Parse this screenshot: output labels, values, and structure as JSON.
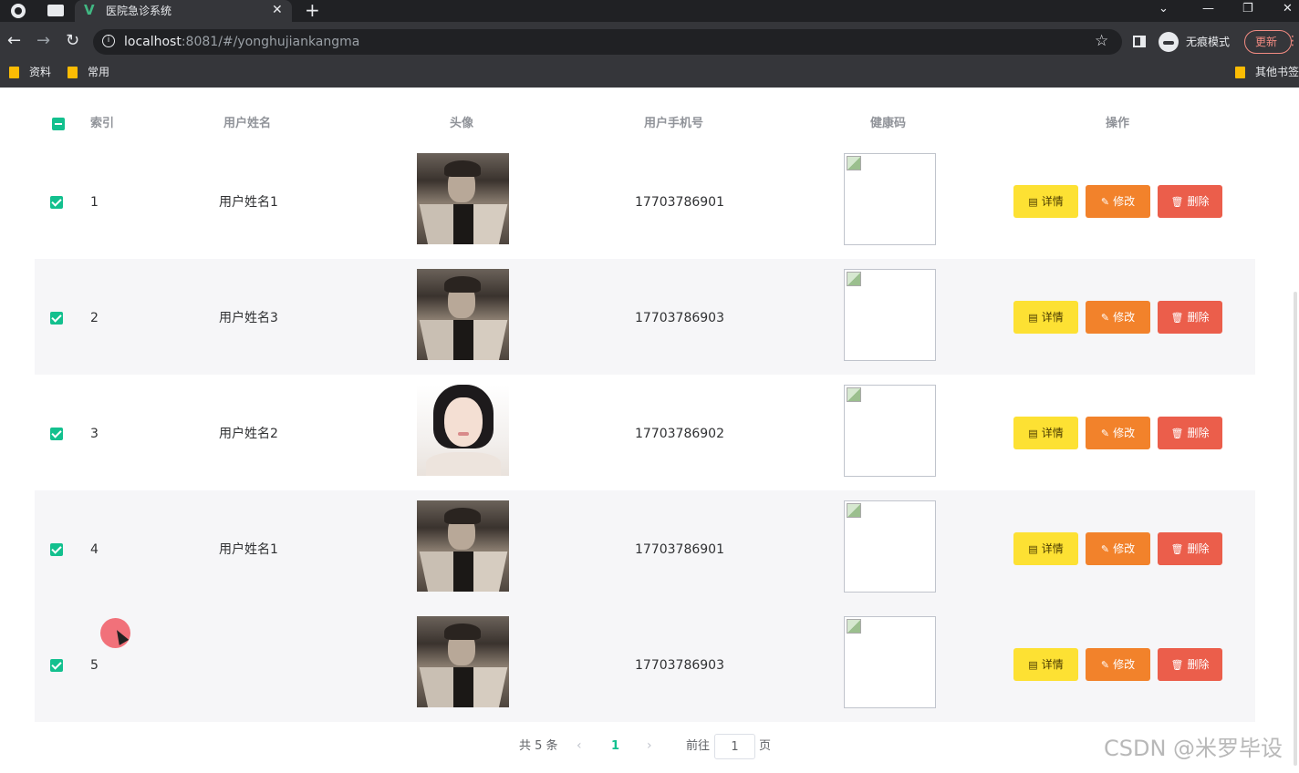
{
  "browser": {
    "tab_title": "医院急诊系统",
    "tab_logo": "V",
    "url_host": "localhost",
    "url_path": ":8081/#/yonghujiankangma",
    "incognito_label": "无痕模式",
    "update_label": "更新",
    "bookmarks": [
      "资料",
      "常用",
      "其他书签"
    ],
    "icons": [
      "globe-icon",
      "window-icon",
      "close-icon",
      "new-tab-icon",
      "back-icon",
      "forward-icon",
      "reload-icon",
      "info-icon",
      "star-icon",
      "side-panel-icon",
      "incognito-icon",
      "more-icon",
      "folder-icon"
    ]
  },
  "table": {
    "headers": {
      "index": "索引",
      "name": "用户姓名",
      "avatar": "头像",
      "phone": "用户手机号",
      "health_code": "健康码",
      "actions": "操作"
    },
    "rows": [
      {
        "index": "1",
        "name": "用户姓名1",
        "phone": "17703786901",
        "avatar": "male",
        "checked": true
      },
      {
        "index": "2",
        "name": "用户姓名3",
        "phone": "17703786903",
        "avatar": "male",
        "checked": true
      },
      {
        "index": "3",
        "name": "用户姓名2",
        "phone": "17703786902",
        "avatar": "female",
        "checked": true
      },
      {
        "index": "4",
        "name": "用户姓名1",
        "phone": "17703786901",
        "avatar": "male",
        "checked": true
      },
      {
        "index": "5",
        "name": "",
        "phone": "17703786903",
        "avatar": "male",
        "checked": true
      }
    ],
    "buttons": {
      "detail": "详情",
      "edit": "修改",
      "delete": "删除"
    }
  },
  "pagination": {
    "total": "共 5 条",
    "current_page": "1",
    "goto_label": "前往",
    "goto_value": "1",
    "page_suffix": "页"
  },
  "watermark": "CSDN @米罗毕设",
  "colors": {
    "accent": "#13c08e",
    "detail_button": "#fde133",
    "edit_button": "#f2822b",
    "delete_button": "#eb5e4b"
  }
}
